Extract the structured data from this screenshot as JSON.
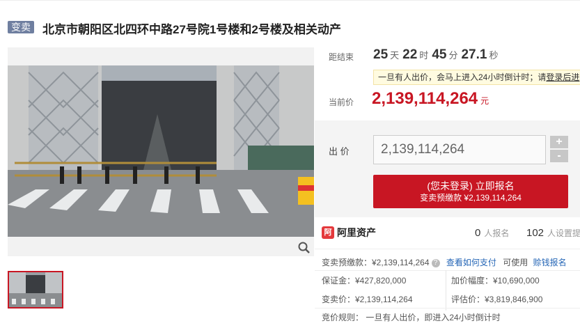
{
  "header": {
    "tag": "变卖",
    "title": "北京市朝阳区北四环中路27号院1号楼和2号楼及相关动产"
  },
  "countdown": {
    "label": "距结束",
    "days": "25",
    "days_unit": "天",
    "hours": "22",
    "hours_unit": "时",
    "minutes": "45",
    "minutes_unit": "分",
    "seconds": "27.1",
    "seconds_unit": "秒"
  },
  "notice": {
    "text": "一旦有人出价，会马上进入24小时倒计时；请",
    "link": "登录后进"
  },
  "current_price": {
    "label": "当前价",
    "value": "2,139,114,264",
    "unit": "元"
  },
  "bid": {
    "label": "出 价",
    "value": "2,139,114,264",
    "plus": "+",
    "minus": "-",
    "button_line1": "(您未登录) 立即报名",
    "button_line2": "变卖预缴款 ¥2,139,114,264"
  },
  "stats": {
    "brand_mark": "阿",
    "brand": "阿里资产",
    "signup_count": "0",
    "signup_label": "人报名",
    "reminder_count": "102",
    "reminder_label": "人设置提"
  },
  "details": {
    "deposit_label": "变卖预缴款：¥2,139,114,264",
    "help_icon": "?",
    "how_to_pay": "查看如何支付",
    "usable_label": "可使用",
    "usable_link": "赊钱报名",
    "margin": "保证金：¥427,820,000",
    "increment": "加价幅度：¥10,690,000",
    "sell_price": "变卖价：¥2,139,114,264",
    "appraisal": "评估价：¥3,819,846,900",
    "rule": "竞价规则：  一旦有人出价，即进入24小时倒计时"
  }
}
